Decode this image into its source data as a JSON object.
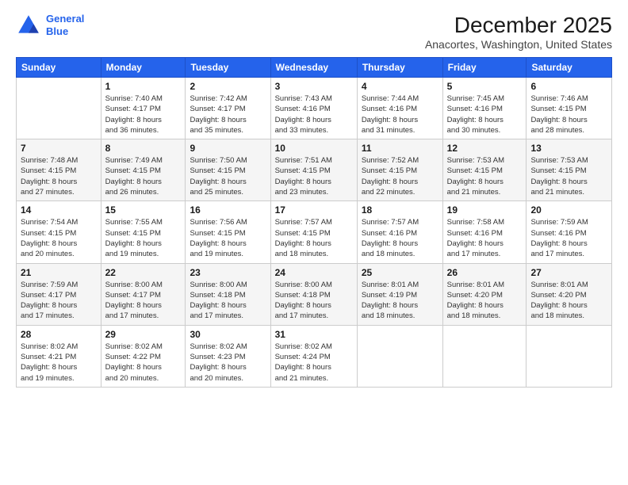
{
  "logo": {
    "line1": "General",
    "line2": "Blue"
  },
  "title": "December 2025",
  "location": "Anacortes, Washington, United States",
  "days_header": [
    "Sunday",
    "Monday",
    "Tuesday",
    "Wednesday",
    "Thursday",
    "Friday",
    "Saturday"
  ],
  "weeks": [
    [
      {
        "num": "",
        "detail": ""
      },
      {
        "num": "1",
        "detail": "Sunrise: 7:40 AM\nSunset: 4:17 PM\nDaylight: 8 hours\nand 36 minutes."
      },
      {
        "num": "2",
        "detail": "Sunrise: 7:42 AM\nSunset: 4:17 PM\nDaylight: 8 hours\nand 35 minutes."
      },
      {
        "num": "3",
        "detail": "Sunrise: 7:43 AM\nSunset: 4:16 PM\nDaylight: 8 hours\nand 33 minutes."
      },
      {
        "num": "4",
        "detail": "Sunrise: 7:44 AM\nSunset: 4:16 PM\nDaylight: 8 hours\nand 31 minutes."
      },
      {
        "num": "5",
        "detail": "Sunrise: 7:45 AM\nSunset: 4:16 PM\nDaylight: 8 hours\nand 30 minutes."
      },
      {
        "num": "6",
        "detail": "Sunrise: 7:46 AM\nSunset: 4:15 PM\nDaylight: 8 hours\nand 28 minutes."
      }
    ],
    [
      {
        "num": "7",
        "detail": "Sunrise: 7:48 AM\nSunset: 4:15 PM\nDaylight: 8 hours\nand 27 minutes."
      },
      {
        "num": "8",
        "detail": "Sunrise: 7:49 AM\nSunset: 4:15 PM\nDaylight: 8 hours\nand 26 minutes."
      },
      {
        "num": "9",
        "detail": "Sunrise: 7:50 AM\nSunset: 4:15 PM\nDaylight: 8 hours\nand 25 minutes."
      },
      {
        "num": "10",
        "detail": "Sunrise: 7:51 AM\nSunset: 4:15 PM\nDaylight: 8 hours\nand 23 minutes."
      },
      {
        "num": "11",
        "detail": "Sunrise: 7:52 AM\nSunset: 4:15 PM\nDaylight: 8 hours\nand 22 minutes."
      },
      {
        "num": "12",
        "detail": "Sunrise: 7:53 AM\nSunset: 4:15 PM\nDaylight: 8 hours\nand 21 minutes."
      },
      {
        "num": "13",
        "detail": "Sunrise: 7:53 AM\nSunset: 4:15 PM\nDaylight: 8 hours\nand 21 minutes."
      }
    ],
    [
      {
        "num": "14",
        "detail": "Sunrise: 7:54 AM\nSunset: 4:15 PM\nDaylight: 8 hours\nand 20 minutes."
      },
      {
        "num": "15",
        "detail": "Sunrise: 7:55 AM\nSunset: 4:15 PM\nDaylight: 8 hours\nand 19 minutes."
      },
      {
        "num": "16",
        "detail": "Sunrise: 7:56 AM\nSunset: 4:15 PM\nDaylight: 8 hours\nand 19 minutes."
      },
      {
        "num": "17",
        "detail": "Sunrise: 7:57 AM\nSunset: 4:15 PM\nDaylight: 8 hours\nand 18 minutes."
      },
      {
        "num": "18",
        "detail": "Sunrise: 7:57 AM\nSunset: 4:16 PM\nDaylight: 8 hours\nand 18 minutes."
      },
      {
        "num": "19",
        "detail": "Sunrise: 7:58 AM\nSunset: 4:16 PM\nDaylight: 8 hours\nand 17 minutes."
      },
      {
        "num": "20",
        "detail": "Sunrise: 7:59 AM\nSunset: 4:16 PM\nDaylight: 8 hours\nand 17 minutes."
      }
    ],
    [
      {
        "num": "21",
        "detail": "Sunrise: 7:59 AM\nSunset: 4:17 PM\nDaylight: 8 hours\nand 17 minutes."
      },
      {
        "num": "22",
        "detail": "Sunrise: 8:00 AM\nSunset: 4:17 PM\nDaylight: 8 hours\nand 17 minutes."
      },
      {
        "num": "23",
        "detail": "Sunrise: 8:00 AM\nSunset: 4:18 PM\nDaylight: 8 hours\nand 17 minutes."
      },
      {
        "num": "24",
        "detail": "Sunrise: 8:00 AM\nSunset: 4:18 PM\nDaylight: 8 hours\nand 17 minutes."
      },
      {
        "num": "25",
        "detail": "Sunrise: 8:01 AM\nSunset: 4:19 PM\nDaylight: 8 hours\nand 18 minutes."
      },
      {
        "num": "26",
        "detail": "Sunrise: 8:01 AM\nSunset: 4:20 PM\nDaylight: 8 hours\nand 18 minutes."
      },
      {
        "num": "27",
        "detail": "Sunrise: 8:01 AM\nSunset: 4:20 PM\nDaylight: 8 hours\nand 18 minutes."
      }
    ],
    [
      {
        "num": "28",
        "detail": "Sunrise: 8:02 AM\nSunset: 4:21 PM\nDaylight: 8 hours\nand 19 minutes."
      },
      {
        "num": "29",
        "detail": "Sunrise: 8:02 AM\nSunset: 4:22 PM\nDaylight: 8 hours\nand 20 minutes."
      },
      {
        "num": "30",
        "detail": "Sunrise: 8:02 AM\nSunset: 4:23 PM\nDaylight: 8 hours\nand 20 minutes."
      },
      {
        "num": "31",
        "detail": "Sunrise: 8:02 AM\nSunset: 4:24 PM\nDaylight: 8 hours\nand 21 minutes."
      },
      {
        "num": "",
        "detail": ""
      },
      {
        "num": "",
        "detail": ""
      },
      {
        "num": "",
        "detail": ""
      }
    ]
  ]
}
